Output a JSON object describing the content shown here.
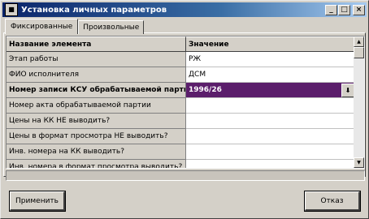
{
  "window": {
    "title": "Установка личных параметров",
    "icon": "app-icon",
    "minimize": "_",
    "maximize": "□",
    "close": "×"
  },
  "tabs": [
    {
      "label": "Фиксированные",
      "active": true
    },
    {
      "label": "Произвольные",
      "active": false
    }
  ],
  "grid": {
    "header": {
      "name": "Название элемента",
      "value": "Значение"
    },
    "rows": [
      {
        "name": "Этап работы",
        "value": "РЖ"
      },
      {
        "name": "ФИО исполнителя",
        "value": "ДСМ"
      },
      {
        "name": "Номер записи КСУ обрабатываемой партии",
        "value": "1996/26",
        "selected": true
      },
      {
        "name": "Номер акта обрабатываемой партии",
        "value": ""
      },
      {
        "name": "Цены на КК НЕ выводить?",
        "value": ""
      },
      {
        "name": "Цены в формат просмотра НЕ выводить?",
        "value": ""
      },
      {
        "name": "Инв. номера на КК выводить?",
        "value": ""
      },
      {
        "name": "Инв. номера в формат просмотра выводить?",
        "value": ""
      }
    ],
    "combo_arrow": "⬇"
  },
  "buttons": {
    "apply": "Применить",
    "cancel": "Отказ"
  }
}
